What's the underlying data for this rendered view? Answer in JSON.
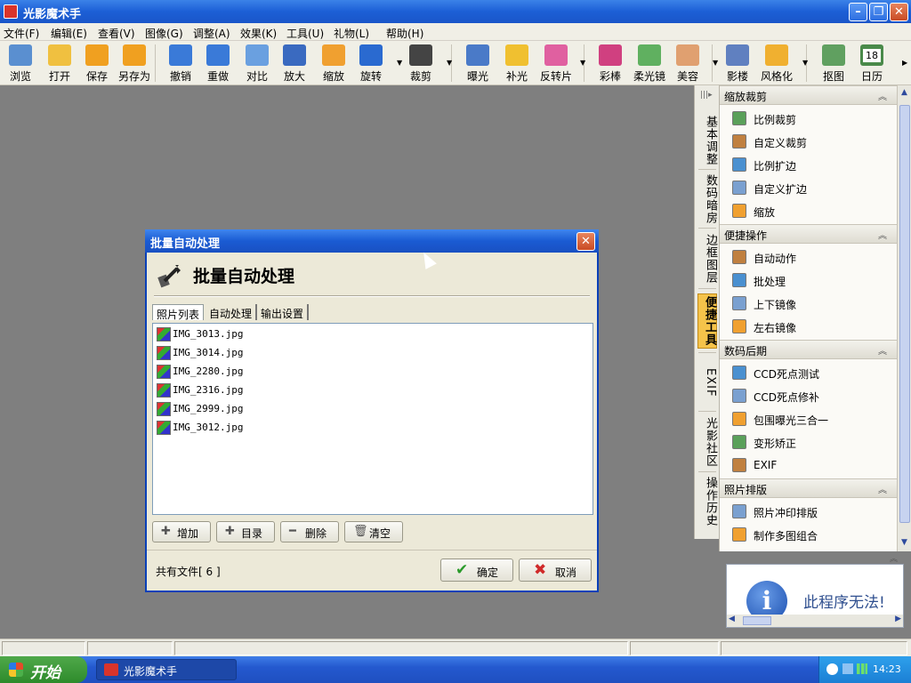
{
  "window": {
    "title": "光影魔术手"
  },
  "menubar": {
    "items": [
      "文件(F)",
      "编辑(E)",
      "查看(V)",
      "图像(G)",
      "调整(A)",
      "效果(K)",
      "工具(U)",
      "礼物(L)",
      "帮助(H)"
    ]
  },
  "toolbar": {
    "tools": [
      {
        "label": "浏览",
        "icon": "eye-icon",
        "color": "#5a8fd0"
      },
      {
        "label": "打开",
        "icon": "folder-open-icon",
        "color": "#f0c040"
      },
      {
        "label": "保存",
        "icon": "save-icon",
        "color": "#f0a020"
      },
      {
        "label": "另存为",
        "icon": "save-as-icon",
        "color": "#f0a020"
      },
      {
        "label": "撤销",
        "icon": "undo-icon",
        "color": "#3a7ad8"
      },
      {
        "label": "重做",
        "icon": "redo-icon",
        "color": "#3a7ad8"
      },
      {
        "label": "对比",
        "icon": "compare-icon",
        "color": "#6aa0e0"
      },
      {
        "label": "放大",
        "icon": "zoom-in-icon",
        "color": "#3a6ac0"
      },
      {
        "label": "缩放",
        "icon": "resize-icon",
        "color": "#f0a030"
      },
      {
        "label": "旋转",
        "icon": "rotate-icon",
        "color": "#2a6ad0"
      },
      {
        "label": "裁剪",
        "icon": "crop-icon",
        "color": "#444444"
      },
      {
        "label": "曝光",
        "icon": "exposure-icon",
        "color": "#4a7ac8"
      },
      {
        "label": "补光",
        "icon": "fill-light-icon",
        "color": "#f0c030"
      },
      {
        "label": "反转片",
        "icon": "film-icon",
        "color": "#e060a0"
      },
      {
        "label": "彩棒",
        "icon": "color-wand-icon",
        "color": "#d04080"
      },
      {
        "label": "柔光镜",
        "icon": "soft-lens-icon",
        "color": "#60b060"
      },
      {
        "label": "美容",
        "icon": "beauty-icon",
        "color": "#e0a070"
      },
      {
        "label": "影楼",
        "icon": "studio-icon",
        "color": "#6080c0"
      },
      {
        "label": "风格化",
        "icon": "stylize-icon",
        "color": "#f0b030"
      },
      {
        "label": "抠图",
        "icon": "cutout-icon",
        "color": "#60a060"
      },
      {
        "label": "日历",
        "icon": "calendar-icon",
        "color": "#4a8a4a",
        "badge": "18"
      }
    ]
  },
  "sidetabs": [
    {
      "label": "基本调整",
      "active": false
    },
    {
      "label": "数码暗房",
      "active": false
    },
    {
      "label": "边框图层",
      "active": false
    },
    {
      "label": "便捷工具",
      "active": true
    },
    {
      "label": "EXIF",
      "active": false
    },
    {
      "label": "光影社区",
      "active": false
    },
    {
      "label": "操作历史",
      "active": false
    }
  ],
  "panel": {
    "sections": [
      {
        "title": "缩放裁剪",
        "items": [
          {
            "label": "比例裁剪",
            "icon": "ratio-crop-icon"
          },
          {
            "label": "自定义裁剪",
            "icon": "custom-crop-icon"
          },
          {
            "label": "比例扩边",
            "icon": "ratio-border-icon"
          },
          {
            "label": "自定义扩边",
            "icon": "custom-border-icon"
          },
          {
            "label": "缩放",
            "icon": "resize-icon"
          }
        ]
      },
      {
        "title": "便捷操作",
        "items": [
          {
            "label": "自动动作",
            "icon": "auto-action-icon"
          },
          {
            "label": "批处理",
            "icon": "batch-icon"
          },
          {
            "label": "上下镜像",
            "icon": "flip-vertical-icon"
          },
          {
            "label": "左右镜像",
            "icon": "flip-horizontal-icon"
          }
        ]
      },
      {
        "title": "数码后期",
        "items": [
          {
            "label": "CCD死点测试",
            "icon": "ccd-test-icon"
          },
          {
            "label": "CCD死点修补",
            "icon": "ccd-repair-icon"
          },
          {
            "label": "包围曝光三合一",
            "icon": "bracket-exposure-icon"
          },
          {
            "label": "变形矫正",
            "icon": "distortion-icon"
          },
          {
            "label": "EXIF",
            "icon": "exif-icon"
          }
        ]
      },
      {
        "title": "照片排版",
        "items": [
          {
            "label": "照片冲印排版",
            "icon": "print-layout-icon"
          },
          {
            "label": "制作多图组合",
            "icon": "collage-icon"
          }
        ]
      }
    ]
  },
  "infobox": {
    "icon_letter": "i",
    "text": "此程序无法!"
  },
  "dialog": {
    "title": "批量自动处理",
    "heading": "批量自动处理",
    "tabs": [
      {
        "label": "照片列表",
        "active": true
      },
      {
        "label": "自动处理",
        "active": false
      },
      {
        "label": "输出设置",
        "active": false
      }
    ],
    "files": [
      "IMG_3013.jpg",
      "IMG_3014.jpg",
      "IMG_2280.jpg",
      "IMG_2316.jpg",
      "IMG_2999.jpg",
      "IMG_3012.jpg"
    ],
    "buttons": [
      {
        "label": "增加",
        "glyph": "✚"
      },
      {
        "label": "目录",
        "glyph": "✚"
      },
      {
        "label": "删除",
        "glyph": "━"
      },
      {
        "label": "清空",
        "glyph": "🗑"
      }
    ],
    "file_count": "共有文件[ 6 ]",
    "ok_label": "确定",
    "cancel_label": "取消"
  },
  "taskbar": {
    "start_label": "开始",
    "app_label": "光影魔术手",
    "clock": "14:23"
  }
}
